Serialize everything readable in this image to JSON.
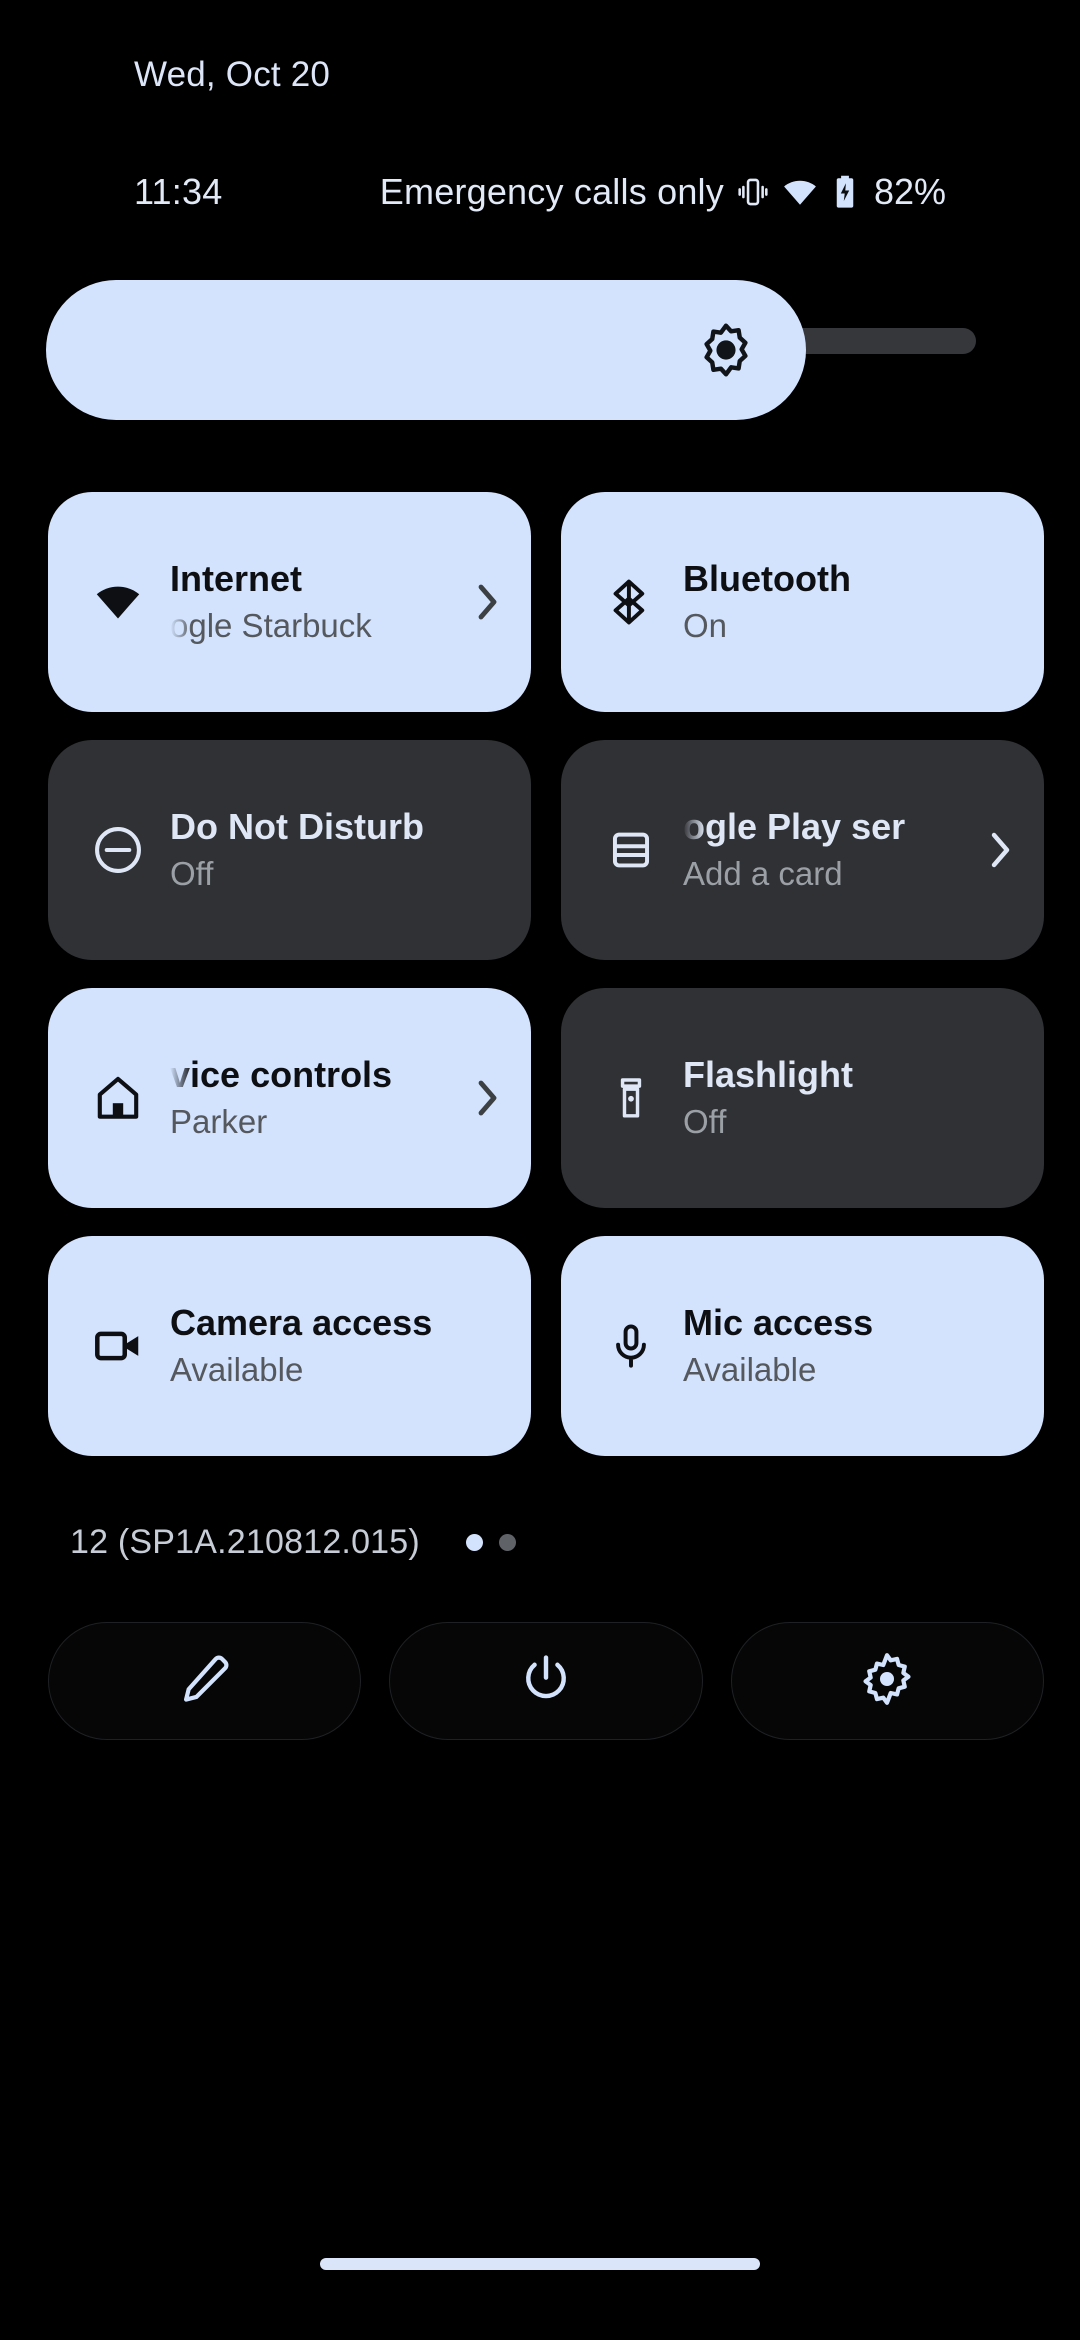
{
  "header": {
    "date": "Wed, Oct 20"
  },
  "status_bar": {
    "clock": "11:34",
    "carrier": "Emergency calls only",
    "battery_percent": "82%",
    "icons": [
      "vibrate-icon",
      "wifi-icon",
      "battery-charging-icon"
    ]
  },
  "brightness": {
    "icon": "brightness-icon",
    "level_percent": 83
  },
  "tiles": [
    {
      "name": "internet",
      "icon": "wifi-icon",
      "title": "Internet",
      "subtitle": "ogle Starbuck",
      "state": "active",
      "title_marquee": false,
      "subtitle_marquee": true,
      "chevron": true
    },
    {
      "name": "bluetooth",
      "icon": "bluetooth-icon",
      "title": "Bluetooth",
      "subtitle": "On",
      "state": "active",
      "title_marquee": false,
      "subtitle_marquee": false,
      "chevron": false
    },
    {
      "name": "do-not-disturb",
      "icon": "do-not-disturb-icon",
      "title": "Do Not Disturb",
      "subtitle": "Off",
      "state": "inactive",
      "title_marquee": false,
      "subtitle_marquee": false,
      "chevron": false
    },
    {
      "name": "google-play-services",
      "icon": "credit-card-icon",
      "title": "ogle Play ser",
      "subtitle": "Add a card",
      "state": "inactive",
      "title_marquee": true,
      "subtitle_marquee": false,
      "chevron": true
    },
    {
      "name": "device-controls",
      "icon": "home-icon",
      "title": "vice controls",
      "subtitle": "Parker",
      "state": "active",
      "title_marquee": true,
      "subtitle_marquee": false,
      "chevron": true
    },
    {
      "name": "flashlight",
      "icon": "flashlight-icon",
      "title": "Flashlight",
      "subtitle": "Off",
      "state": "inactive",
      "title_marquee": false,
      "subtitle_marquee": false,
      "chevron": false
    },
    {
      "name": "camera-access",
      "icon": "camera-icon",
      "title": "Camera access",
      "subtitle": "Available",
      "state": "active",
      "title_marquee": false,
      "subtitle_marquee": false,
      "chevron": false
    },
    {
      "name": "mic-access",
      "icon": "microphone-icon",
      "title": "Mic access",
      "subtitle": "Available",
      "state": "active",
      "title_marquee": false,
      "subtitle_marquee": false,
      "chevron": false
    }
  ],
  "footer": {
    "build": "12 (SP1A.210812.015)",
    "page_dots": {
      "count": 2,
      "active_index": 0
    },
    "buttons": [
      {
        "name": "edit-button",
        "icon": "pencil-icon"
      },
      {
        "name": "power-button",
        "icon": "power-icon"
      },
      {
        "name": "settings-button",
        "icon": "gear-icon"
      }
    ]
  },
  "colors": {
    "background": "#000000",
    "tile_active": "#d3e3fd",
    "tile_inactive": "#2f3134",
    "accent_text": "#dfe7f6",
    "slider_track": "#35373b",
    "nav_pill": "#dbe5f9"
  }
}
